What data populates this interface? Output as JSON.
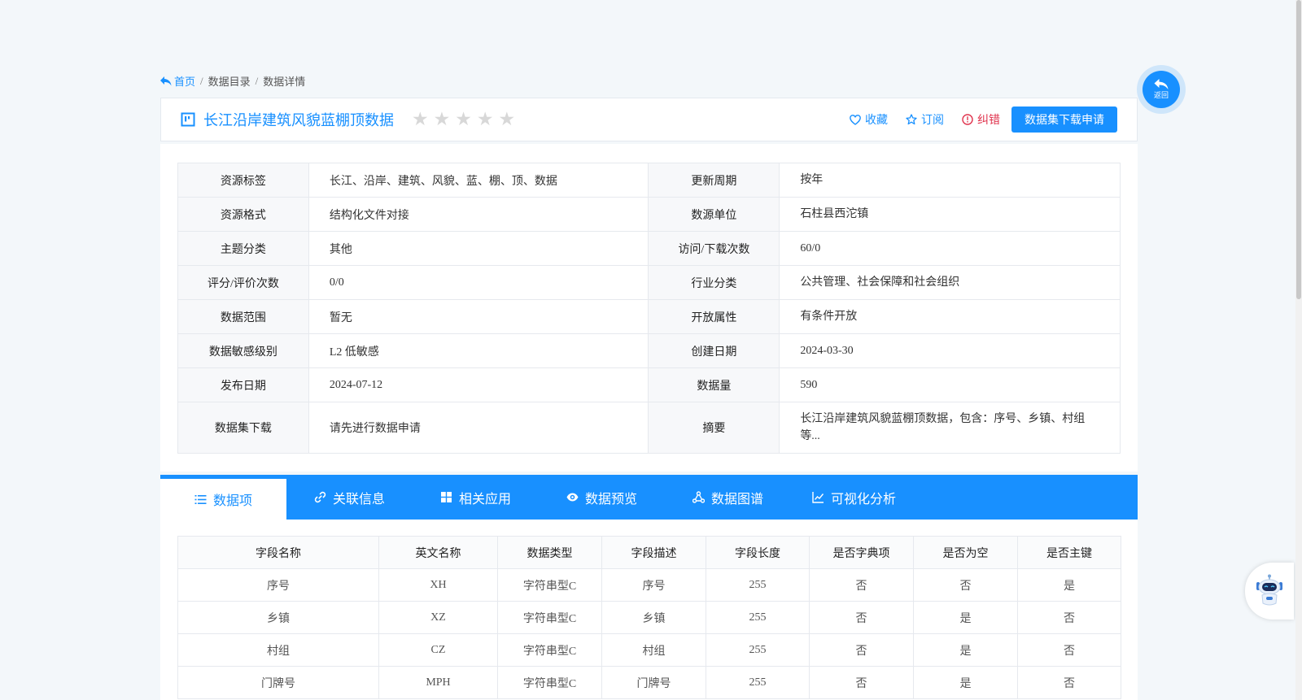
{
  "breadcrumb": {
    "home": "首页",
    "sep1": "/",
    "catalog": "数据目录",
    "sep2": "/",
    "current": "数据详情"
  },
  "header": {
    "title": "长江沿岸建筑风貌蓝棚顶数据",
    "rating_stars": 0,
    "rating_max": 5,
    "favorite_label": "收藏",
    "subscribe_label": "订阅",
    "report_label": "纠错",
    "apply_label": "数据集下载申请"
  },
  "info": {
    "rows": [
      {
        "l1": "资源标签",
        "v1": "长江、沿岸、建筑、风貌、蓝、棚、顶、数据",
        "l2": "更新周期",
        "v2": "按年"
      },
      {
        "l1": "资源格式",
        "v1": "结构化文件对接",
        "l2": "数源单位",
        "v2": "石柱县西沱镇"
      },
      {
        "l1": "主题分类",
        "v1": "其他",
        "l2": "访问/下载次数",
        "v2": "60/0"
      },
      {
        "l1": "评分/评价次数",
        "v1": "0/0",
        "l2": "行业分类",
        "v2": "公共管理、社会保障和社会组织"
      },
      {
        "l1": "数据范围",
        "v1": "暂无",
        "l2": "开放属性",
        "v2": "有条件开放"
      },
      {
        "l1": "数据敏感级别",
        "v1": "L2 低敏感",
        "l2": "创建日期",
        "v2": "2024-03-30"
      },
      {
        "l1": "发布日期",
        "v1": "2024-07-12",
        "l2": "数据量",
        "v2": "590"
      },
      {
        "l1": "数据集下载",
        "v1": "请先进行数据申请",
        "l2": "摘要",
        "v2": "长江沿岸建筑风貌蓝棚顶数据，包含：序号、乡镇、村组等..."
      }
    ]
  },
  "tabs": [
    {
      "label": "数据项",
      "icon": "list-icon"
    },
    {
      "label": "关联信息",
      "icon": "link-icon"
    },
    {
      "label": "相关应用",
      "icon": "grid-icon"
    },
    {
      "label": "数据预览",
      "icon": "eye-icon"
    },
    {
      "label": "数据图谱",
      "icon": "graph-icon"
    },
    {
      "label": "可视化分析",
      "icon": "line-chart-icon"
    }
  ],
  "fields": {
    "headers": [
      "字段名称",
      "英文名称",
      "数据类型",
      "字段描述",
      "字段长度",
      "是否字典项",
      "是否为空",
      "是否主键"
    ],
    "rows": [
      [
        "序号",
        "XH",
        "字符串型C",
        "序号",
        "255",
        "否",
        "否",
        "是"
      ],
      [
        "乡镇",
        "XZ",
        "字符串型C",
        "乡镇",
        "255",
        "否",
        "是",
        "否"
      ],
      [
        "村组",
        "CZ",
        "字符串型C",
        "村组",
        "255",
        "否",
        "是",
        "否"
      ],
      [
        "门牌号",
        "MPH",
        "字符串型C",
        "门牌号",
        "255",
        "否",
        "是",
        "否"
      ]
    ]
  },
  "floating": {
    "back_label": "返回"
  },
  "colors": {
    "primary": "#1890ff",
    "danger": "#e0334d",
    "star_empty": "#d8d8d8"
  }
}
